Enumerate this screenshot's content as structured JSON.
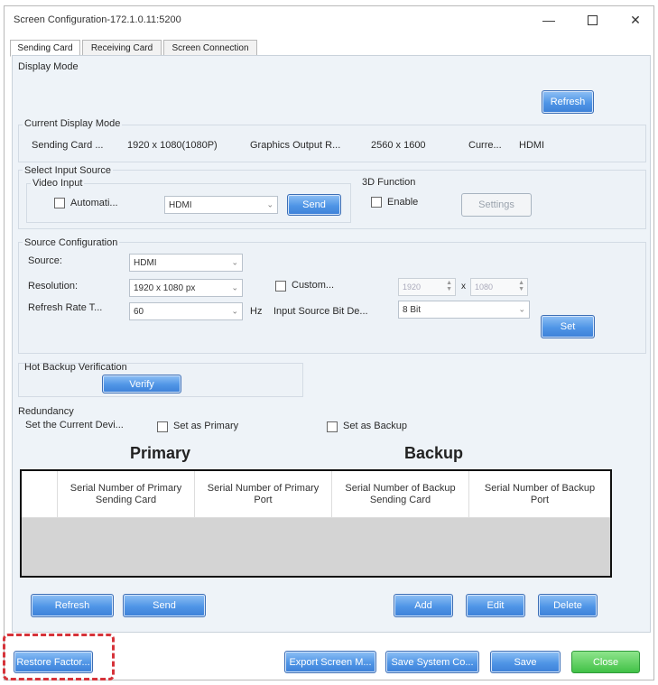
{
  "window": {
    "title": "Screen Configuration-172.1.0.11:5200"
  },
  "tabs": [
    {
      "label": "Sending Card",
      "active": true
    },
    {
      "label": "Receiving Card",
      "active": false
    },
    {
      "label": "Screen Connection",
      "active": false
    }
  ],
  "display_mode": {
    "title": "Display Mode",
    "refresh_label": "Refresh",
    "current_title": "Current Display Mode",
    "sending_card_label": "Sending Card ...",
    "sending_card_value": "1920 x 1080(1080P)",
    "graphics_label": "Graphics Output R...",
    "graphics_value": "2560 x 1600",
    "current_label": "Curre...",
    "current_value": "HDMI"
  },
  "input_source": {
    "title": "Select Input Source",
    "video_input_title": "Video Input",
    "auto_label": "Automati...",
    "auto_checked": false,
    "video_select_value": "HDMI",
    "send_label": "Send",
    "function3d_title": "3D Function",
    "enable_label": "Enable",
    "enable_checked": false,
    "settings_label": "Settings"
  },
  "source_config": {
    "title": "Source Configuration",
    "source_label": "Source:",
    "source_value": "HDMI",
    "resolution_label": "Resolution:",
    "resolution_value": "1920 x 1080 px",
    "custom_label": "Custom...",
    "custom_checked": false,
    "width_value": "1920",
    "height_value": "1080",
    "times_symbol": "x",
    "refresh_rate_label": "Refresh Rate T...",
    "refresh_rate_value": "60",
    "hz_label": "Hz",
    "bit_depth_label": "Input Source Bit De...",
    "bit_depth_value": "8 Bit",
    "set_label": "Set"
  },
  "hot_backup": {
    "title": "Hot Backup Verification",
    "verify_label": "Verify"
  },
  "redundancy": {
    "title": "Redundancy",
    "set_current_label": "Set the Current Devi...",
    "primary_label": "Set as Primary",
    "primary_checked": false,
    "backup_label": "Set as Backup",
    "backup_checked": false,
    "primary_heading": "Primary",
    "backup_heading": "Backup",
    "columns": [
      "Serial Number of Primary Sending Card",
      "Serial Number of Primary Port",
      "Serial Number of Backup Sending Card",
      "Serial Number of Backup Port"
    ],
    "refresh_label": "Refresh",
    "send_label": "Send",
    "add_label": "Add",
    "edit_label": "Edit",
    "delete_label": "Delete"
  },
  "footer": {
    "restore_label": "Restore Factor...",
    "export_label": "Export Screen M...",
    "save_system_label": "Save System Co...",
    "save_label": "Save",
    "close_label": "Close"
  },
  "colors": {
    "accent_blue": "#4f95e6",
    "close_green": "#41c147",
    "highlight_red": "#d6333a",
    "panel_bg": "#eef3f8"
  }
}
